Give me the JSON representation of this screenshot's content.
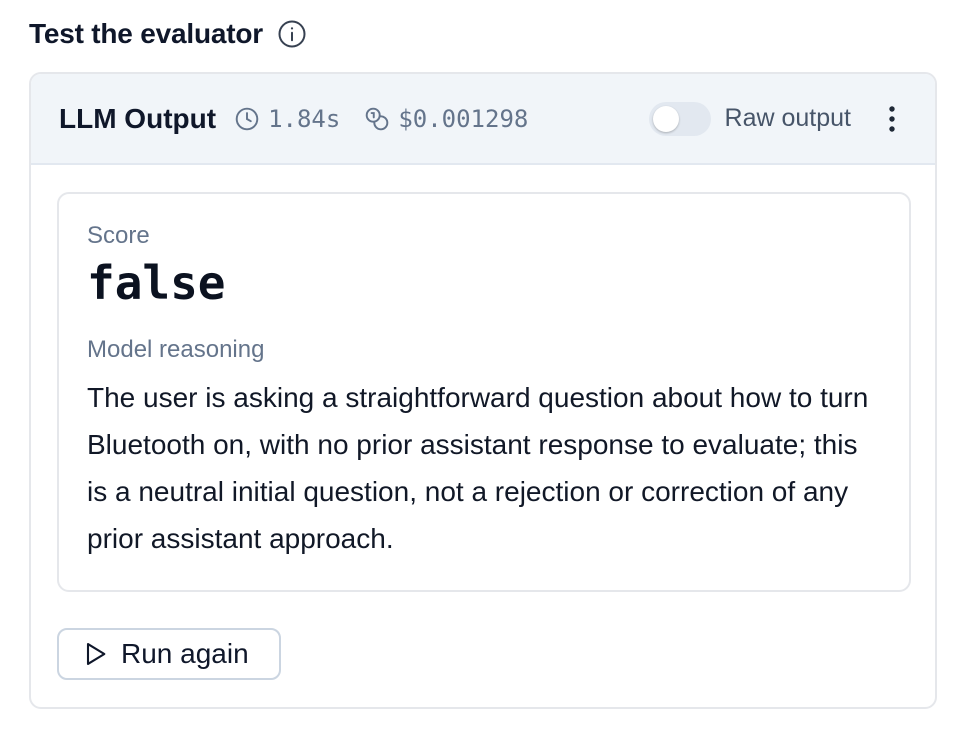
{
  "header": {
    "title": "Test the evaluator",
    "info_icon": "info-icon"
  },
  "card": {
    "title": "LLM Output",
    "latency": "1.84s",
    "cost": "$0.001298",
    "raw_output_label": "Raw output",
    "raw_output_enabled": false,
    "icons": {
      "latency": "clock-icon",
      "cost": "coins-icon",
      "menu": "more-vertical-icon"
    }
  },
  "result": {
    "score_label": "Score",
    "score_value": "false",
    "reasoning_label": "Model reasoning",
    "reasoning_text": "The user is asking a straightforward question about how to turn Bluetooth on, with no prior assistant response to evaluate; this is a neutral initial question, not a rejection or correction of any prior assistant approach."
  },
  "actions": {
    "run_again_label": "Run again",
    "run_icon": "play-icon"
  },
  "colors": {
    "header_bg": "#f1f5f9",
    "border": "#e5e7eb",
    "muted": "#64748b",
    "toggle_off": "#e2e8f0"
  }
}
